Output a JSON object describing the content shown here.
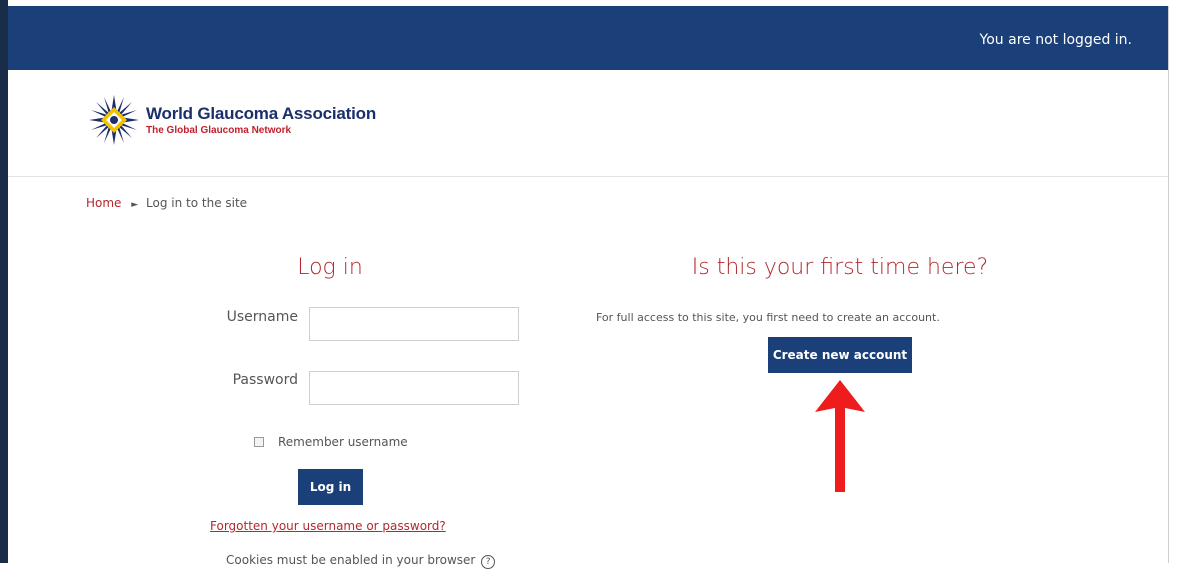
{
  "topbar": {
    "status": "You are not logged in."
  },
  "brand": {
    "name": "World Glaucoma Association",
    "tagline": "The Global Glaucoma Network",
    "primary_color": "#1b3f79",
    "accent_color": "#b3282d"
  },
  "breadcrumb": {
    "home": "Home",
    "current": "Log in to the site"
  },
  "login": {
    "title": "Log in",
    "username_label": "Username",
    "username_value": "",
    "password_label": "Password",
    "password_value": "",
    "remember_label": "Remember username",
    "remember_checked": false,
    "submit_label": "Log in",
    "forgot_link": "Forgotten your username or password?",
    "cookies_note": "Cookies must be enabled in your browser",
    "cookies_help": "?"
  },
  "signup": {
    "title": "Is this your first time here?",
    "text": "For full access to this site, you first need to create an account.",
    "button_label": "Create new account"
  },
  "annotation": {
    "arrow_color": "#ee1c1c"
  }
}
